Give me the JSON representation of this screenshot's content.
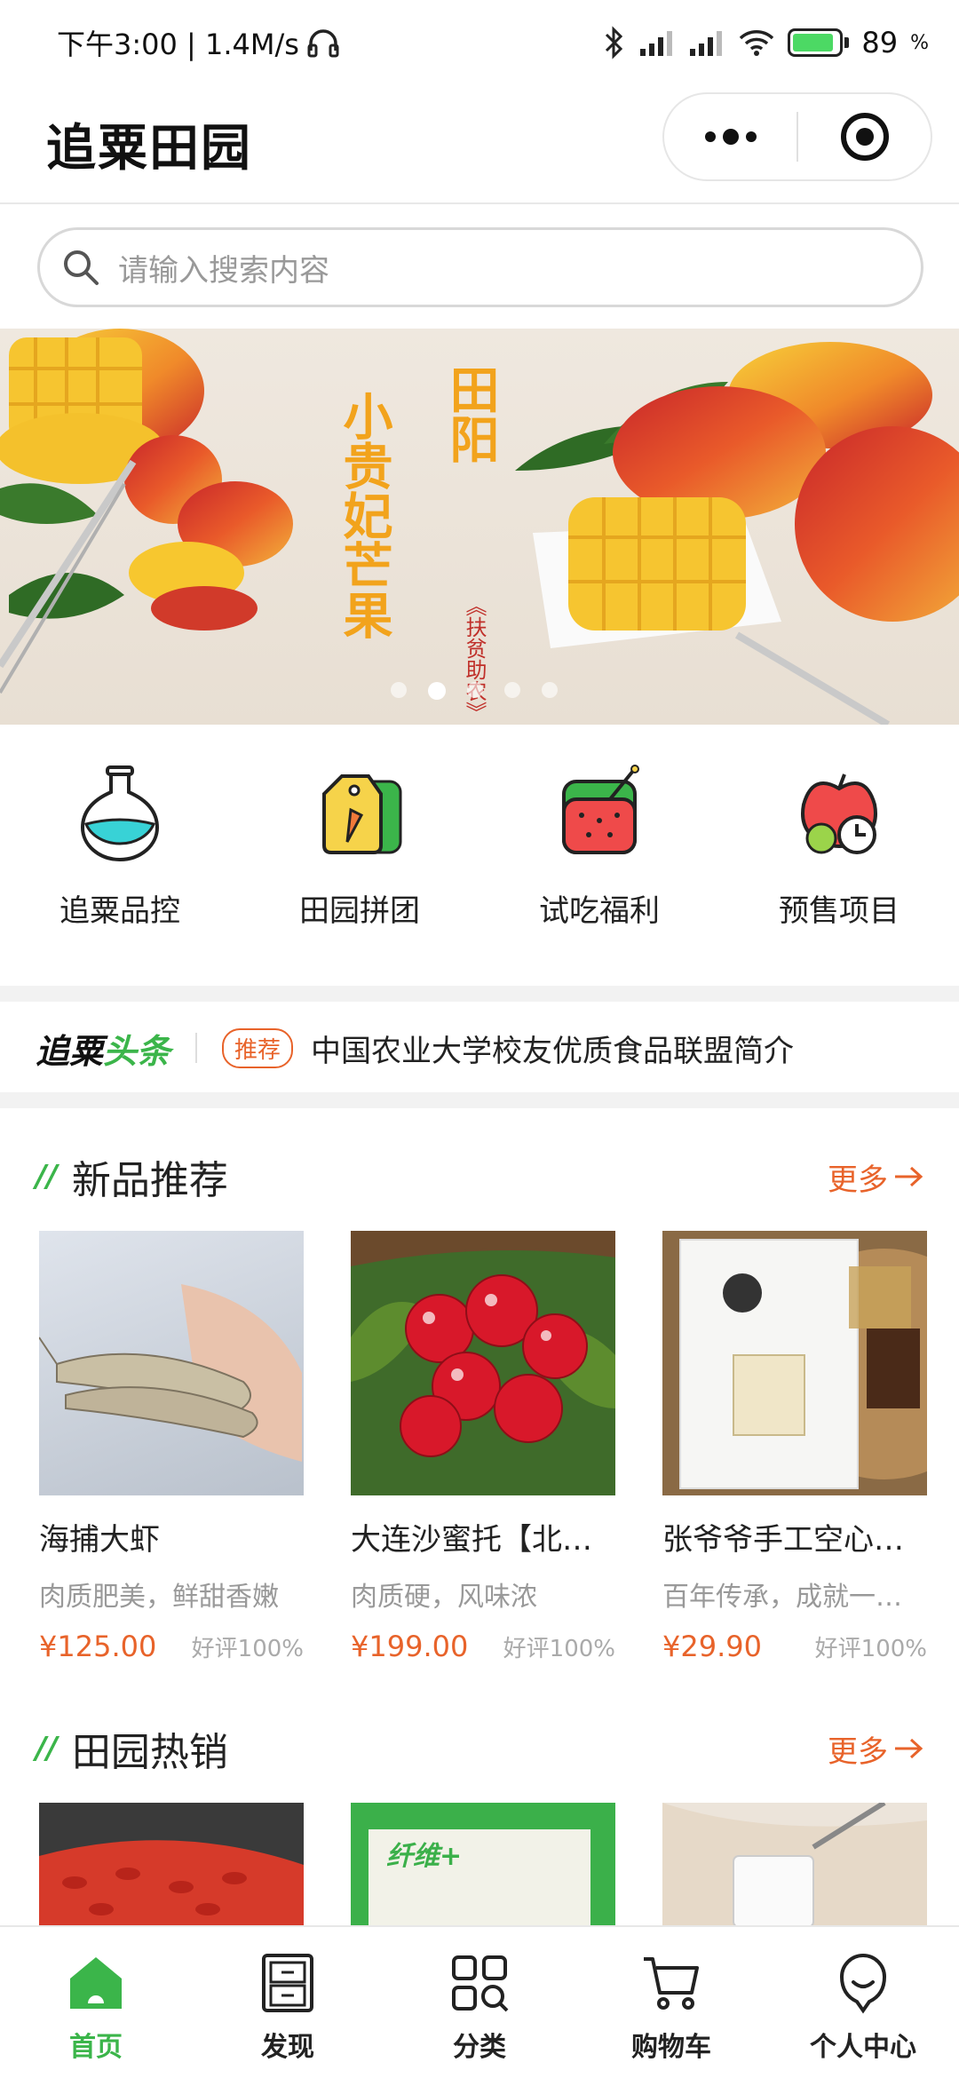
{
  "status_bar": {
    "time_speed": "下午3:00 | 1.4M/s",
    "battery": "89",
    "battery_level": 0.89
  },
  "header": {
    "title": "追粟田园",
    "menu_icon": "more-dots-icon",
    "close_icon": "target-icon"
  },
  "search": {
    "placeholder": "请输入搜索内容"
  },
  "banner": {
    "main_text": "小贵妃芒果",
    "side_text": "田阳",
    "slogan": "《扶贫助农》",
    "slide_count": 5,
    "active_slide": 2
  },
  "quick_menu": [
    {
      "label": "追粟品控",
      "icon": "flask-icon"
    },
    {
      "label": "田园拼团",
      "icon": "carrot-tag-icon"
    },
    {
      "label": "试吃福利",
      "icon": "watermelon-icon"
    },
    {
      "label": "预售项目",
      "icon": "apple-clock-icon"
    }
  ],
  "news": {
    "logo_black": "追粟",
    "logo_green": "头条",
    "tag": "推荐",
    "text": "中国农业大学校友优质食品联盟简介"
  },
  "sections": [
    {
      "title": "新品推荐",
      "more": "更多",
      "products": [
        {
          "name": "海捕大虾",
          "desc": "肉质肥美，鲜甜香嫩",
          "price": "¥125.00",
          "rating": "好评100%"
        },
        {
          "name": "大连沙蜜托【北京现货",
          "desc": "肉质硬，风味浓",
          "price": "¥199.00",
          "rating": "好评100%"
        },
        {
          "name": "张爷爷手工空心挂面",
          "desc": "百年传承，成就一碗好面",
          "price": "¥29.90",
          "rating": "好评100%"
        }
      ]
    },
    {
      "title": "田园热销",
      "more": "更多",
      "products": []
    }
  ],
  "hot_products_images": [
    "goji-image",
    "fiber-box-image",
    "milk-image"
  ],
  "product_images_text": {
    "fiber_box": "纤维+"
  },
  "tabbar": [
    {
      "label": "首页",
      "icon": "home-icon",
      "active": true
    },
    {
      "label": "发现",
      "icon": "cabinet-icon",
      "active": false
    },
    {
      "label": "分类",
      "icon": "category-icon",
      "active": false
    },
    {
      "label": "购物车",
      "icon": "cart-icon",
      "active": false
    },
    {
      "label": "个人中心",
      "icon": "user-icon",
      "active": false
    }
  ],
  "colors": {
    "brand_green": "#3bb54a",
    "accent_orange": "#e8632a"
  }
}
